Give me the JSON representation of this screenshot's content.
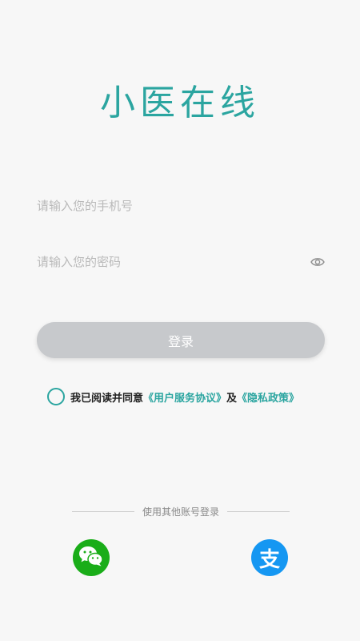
{
  "app": {
    "logo_text": "小医在线",
    "brand_color": "#2ba5a0"
  },
  "form": {
    "phone_placeholder": "请输入您的手机号",
    "password_placeholder": "请输入您的密码",
    "login_label": "登录"
  },
  "agreement": {
    "prefix": "我已阅读并同意",
    "user_agreement": "《用户服务协议》",
    "conjunction": "及",
    "privacy_policy": "《隐私政策》"
  },
  "other_login": {
    "label": "使用其他账号登录",
    "wechat_icon": "wechat-icon",
    "alipay_icon": "alipay-icon",
    "alipay_glyph": "支"
  }
}
